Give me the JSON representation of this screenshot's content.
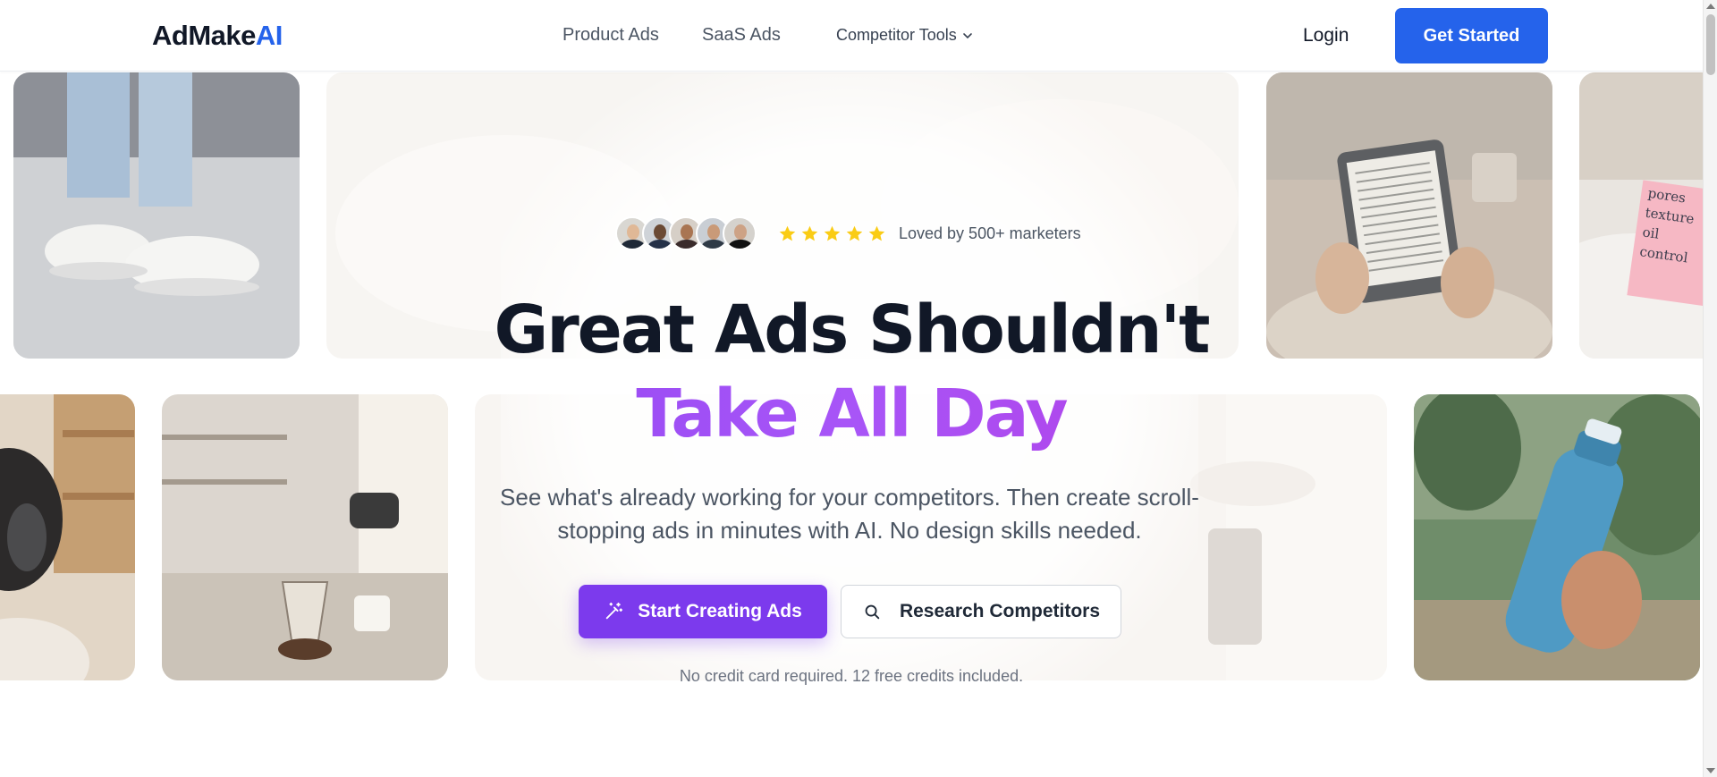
{
  "header": {
    "logo_main": "AdMake",
    "logo_accent": "AI",
    "nav": {
      "product_ads": "Product Ads",
      "saas_ads": "SaaS Ads",
      "competitor_tools": "Competitor Tools"
    },
    "login": "Login",
    "get_started": "Get Started"
  },
  "hero": {
    "social_proof": {
      "avatar_count": 5,
      "star_count": 5,
      "loved_text": "Loved by 500+ marketers"
    },
    "headline_line1": "Great Ads Shouldn't",
    "headline_line2": "Take All Day",
    "subtext": "See what's already working for your competitors. Then create scroll-stopping ads in minutes with AI. No design skills needed.",
    "primary_cta": "Start Creating Ads",
    "secondary_cta": "Research Competitors",
    "fineprint": "No credit card required. 12 free credits included."
  },
  "sticky_note": {
    "line1": "pores",
    "line2": "texture",
    "line3": "oil control"
  },
  "colors": {
    "brand_blue": "#2563eb",
    "brand_purple": "#7c3aed",
    "headline_gradient_end": "#c026d3",
    "star_yellow": "#facc15"
  },
  "icons": {
    "dropdown": "chevron-down-icon",
    "primary_cta": "magic-wand-icon",
    "secondary_cta": "search-icon",
    "rating": "star-icon"
  }
}
